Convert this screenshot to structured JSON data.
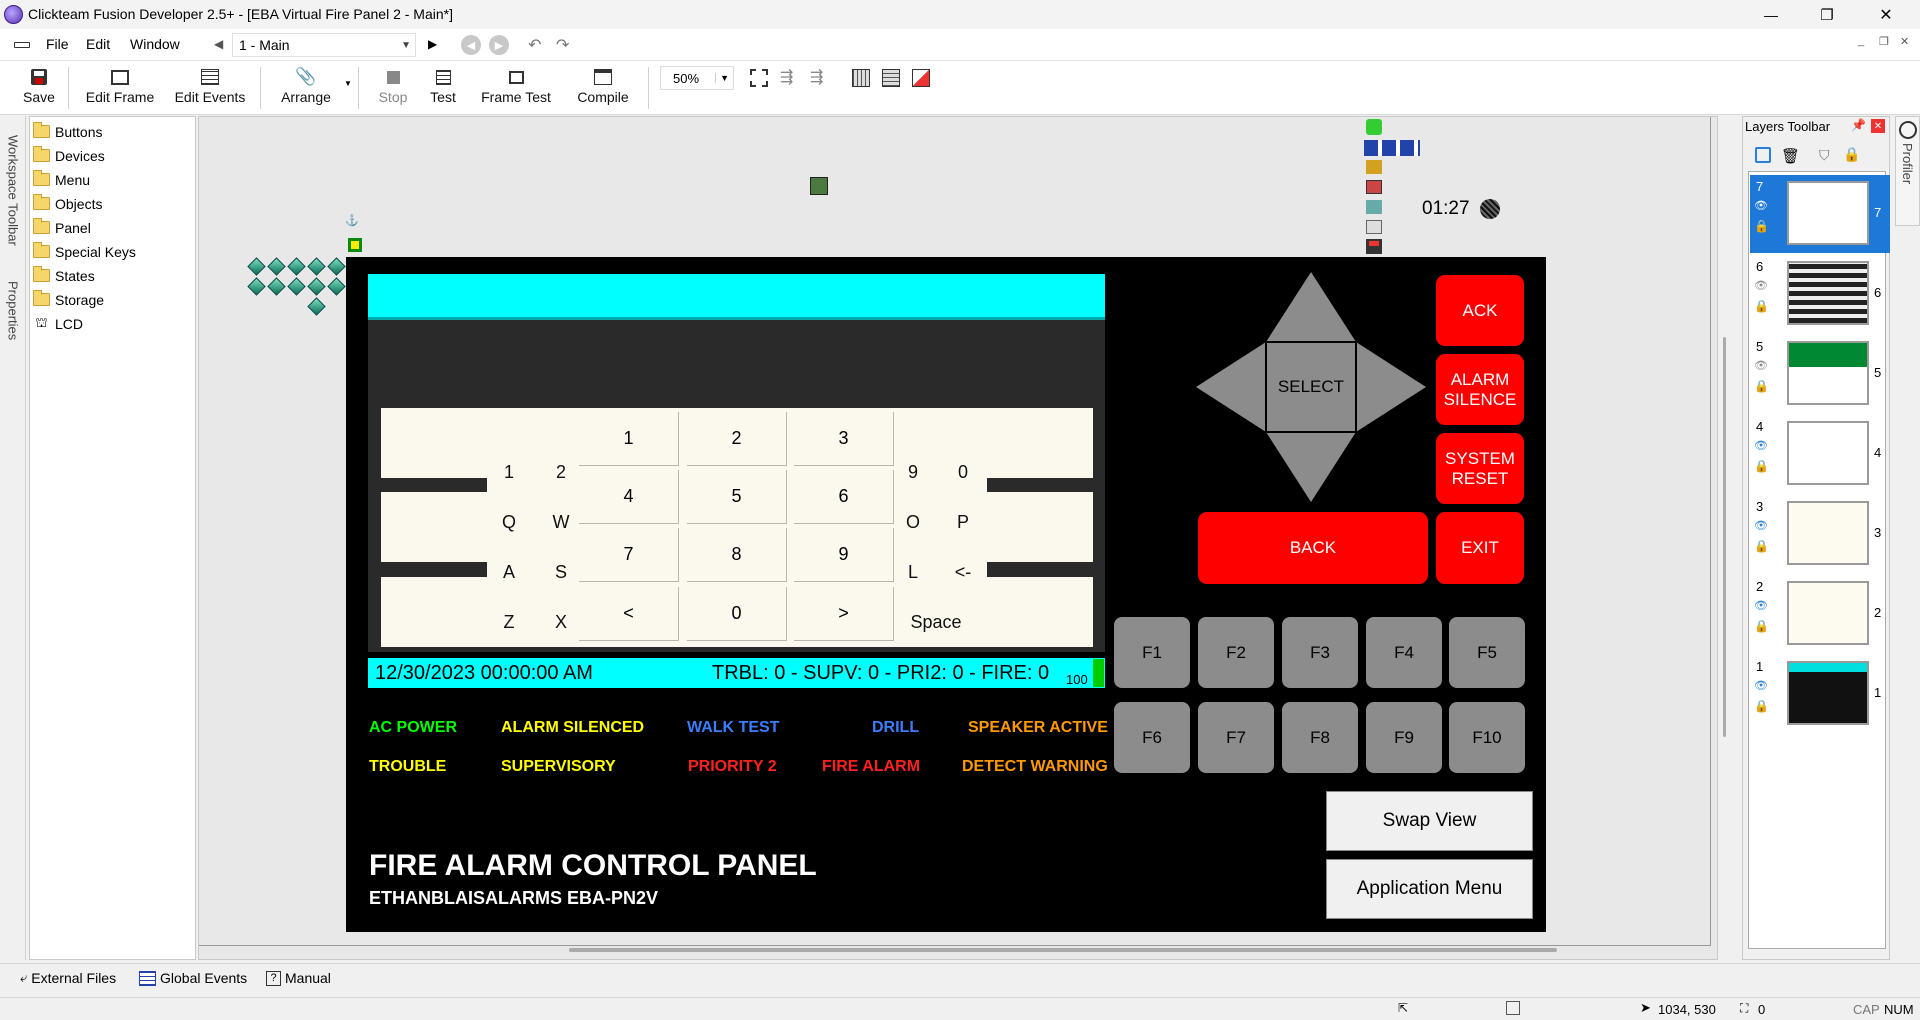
{
  "window": {
    "title": "Clickteam Fusion Developer 2.5+ - [EBA Virtual Fire Panel 2 - Main*]",
    "controls": {
      "minimize": "—",
      "restore": "❐",
      "close": "✕"
    }
  },
  "menu": {
    "items": [
      "File",
      "Edit",
      "Window"
    ],
    "frame_select": "1 - Main",
    "mdi_controls": [
      "_",
      "❐",
      "✕"
    ]
  },
  "toolbar": {
    "buttons": [
      "Save",
      "Edit Frame",
      "Edit Events",
      "Arrange",
      "Stop",
      "Test",
      "Frame Test",
      "Compile"
    ],
    "zoom": "50%"
  },
  "left_tabs": [
    "Workspace Toolbar",
    "Properties"
  ],
  "tree": {
    "items": [
      "Buttons",
      "Devices",
      "Menu",
      "Objects",
      "Panel",
      "Special Keys",
      "States",
      "Storage",
      "LCD"
    ]
  },
  "canvas": {
    "clock": "01:27"
  },
  "panel": {
    "nav_select": "SELECT",
    "red_buttons": {
      "ack": "ACK",
      "alarm_silence": "ALARM SILENCE",
      "system_reset": "SYSTEM RESET",
      "back": "BACK",
      "exit": "EXIT"
    },
    "f_keys": [
      "F1",
      "F2",
      "F3",
      "F4",
      "F5",
      "F6",
      "F7",
      "F8",
      "F9",
      "F10"
    ],
    "swap_view": "Swap View",
    "app_menu": "Application Menu",
    "lcd": {
      "datetime": "12/30/2023 00:00:00 AM",
      "counts": "TRBL: 0 - SUPV: 0 - PRI2: 0 - FIRE: 0",
      "level": "100"
    },
    "keyboard": {
      "row1": [
        "1",
        "2",
        "9",
        "0"
      ],
      "row2": [
        "Q",
        "W",
        "O",
        "P"
      ],
      "row3": [
        "A",
        "S",
        "L",
        "<-"
      ],
      "row4": [
        "Z",
        "X",
        "Space"
      ]
    },
    "numpad": [
      "1",
      "2",
      "3",
      "4",
      "5",
      "6",
      "7",
      "8",
      "9",
      "<",
      "0",
      ">"
    ],
    "status_row1": [
      {
        "label": "AC POWER",
        "color": "#00ff00"
      },
      {
        "label": "ALARM SILENCED",
        "color": "#ffff00"
      },
      {
        "label": "WALK TEST",
        "color": "#3b7dff"
      },
      {
        "label": "DRILL",
        "color": "#3b7dff"
      },
      {
        "label": "SPEAKER ACTIVE",
        "color": "#ff9900"
      }
    ],
    "status_row2": [
      {
        "label": "TROUBLE",
        "color": "#ffff00"
      },
      {
        "label": "SUPERVISORY",
        "color": "#ffff00"
      },
      {
        "label": "PRIORITY 2",
        "color": "#ff2020"
      },
      {
        "label": "FIRE ALARM",
        "color": "#ff2020"
      },
      {
        "label": "DETECT WARNING",
        "color": "#ff9900"
      }
    ],
    "title": "FIRE ALARM CONTROL PANEL",
    "subtitle": "ETHANBLAISALARMS EBA-PN2V"
  },
  "layers": {
    "title": "Layers Toolbar",
    "items": [
      "7",
      "6",
      "5",
      "4",
      "3",
      "2",
      "1"
    ],
    "profiler": "Profiler"
  },
  "bottom_tabs": [
    "External Files",
    "Global Events",
    "Manual"
  ],
  "status": {
    "coords": "1034, 530",
    "count": "0",
    "cap": "CAP",
    "num": "NUM"
  }
}
